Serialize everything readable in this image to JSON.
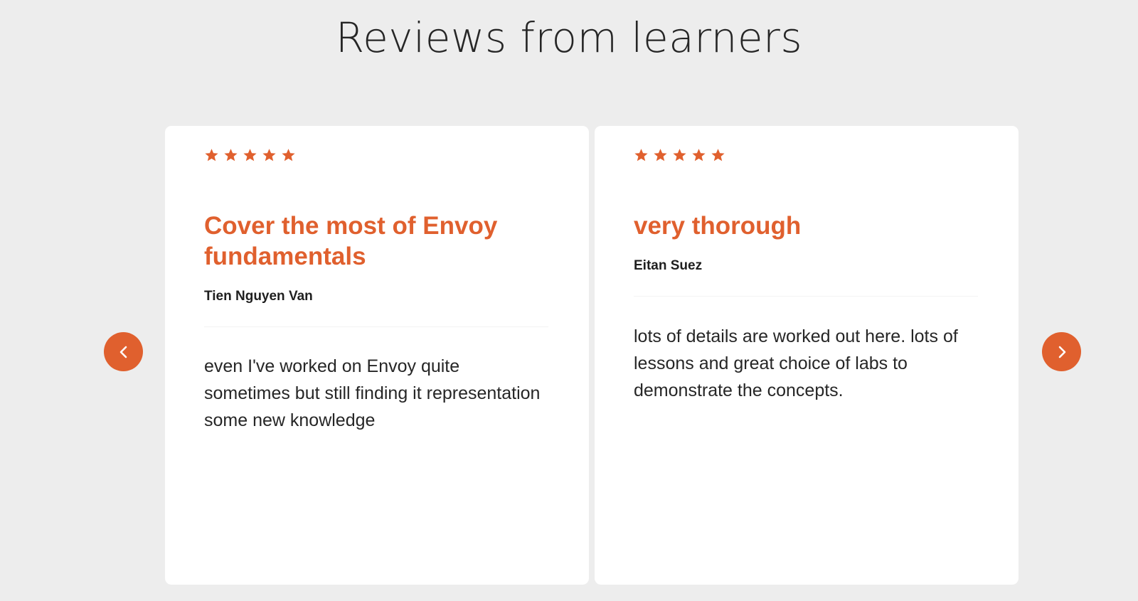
{
  "colors": {
    "accent": "#e0602e",
    "background": "#ededed",
    "card": "#ffffff",
    "text": "#262626"
  },
  "section": {
    "title": "Reviews from learners"
  },
  "carousel": {
    "prev_icon": "chevron-left-icon",
    "next_icon": "chevron-right-icon",
    "reviews": [
      {
        "rating": 5,
        "title": "Cover the most of Envoy fundamentals",
        "author": "Tien Nguyen Van",
        "body": "even I've worked on Envoy quite sometimes but still finding it representation some new knowledge"
      },
      {
        "rating": 5,
        "title": "very thorough",
        "author": "Eitan Suez",
        "body": "lots of details are worked out here. lots of lessons and great choice of labs to demonstrate the concepts."
      }
    ]
  }
}
